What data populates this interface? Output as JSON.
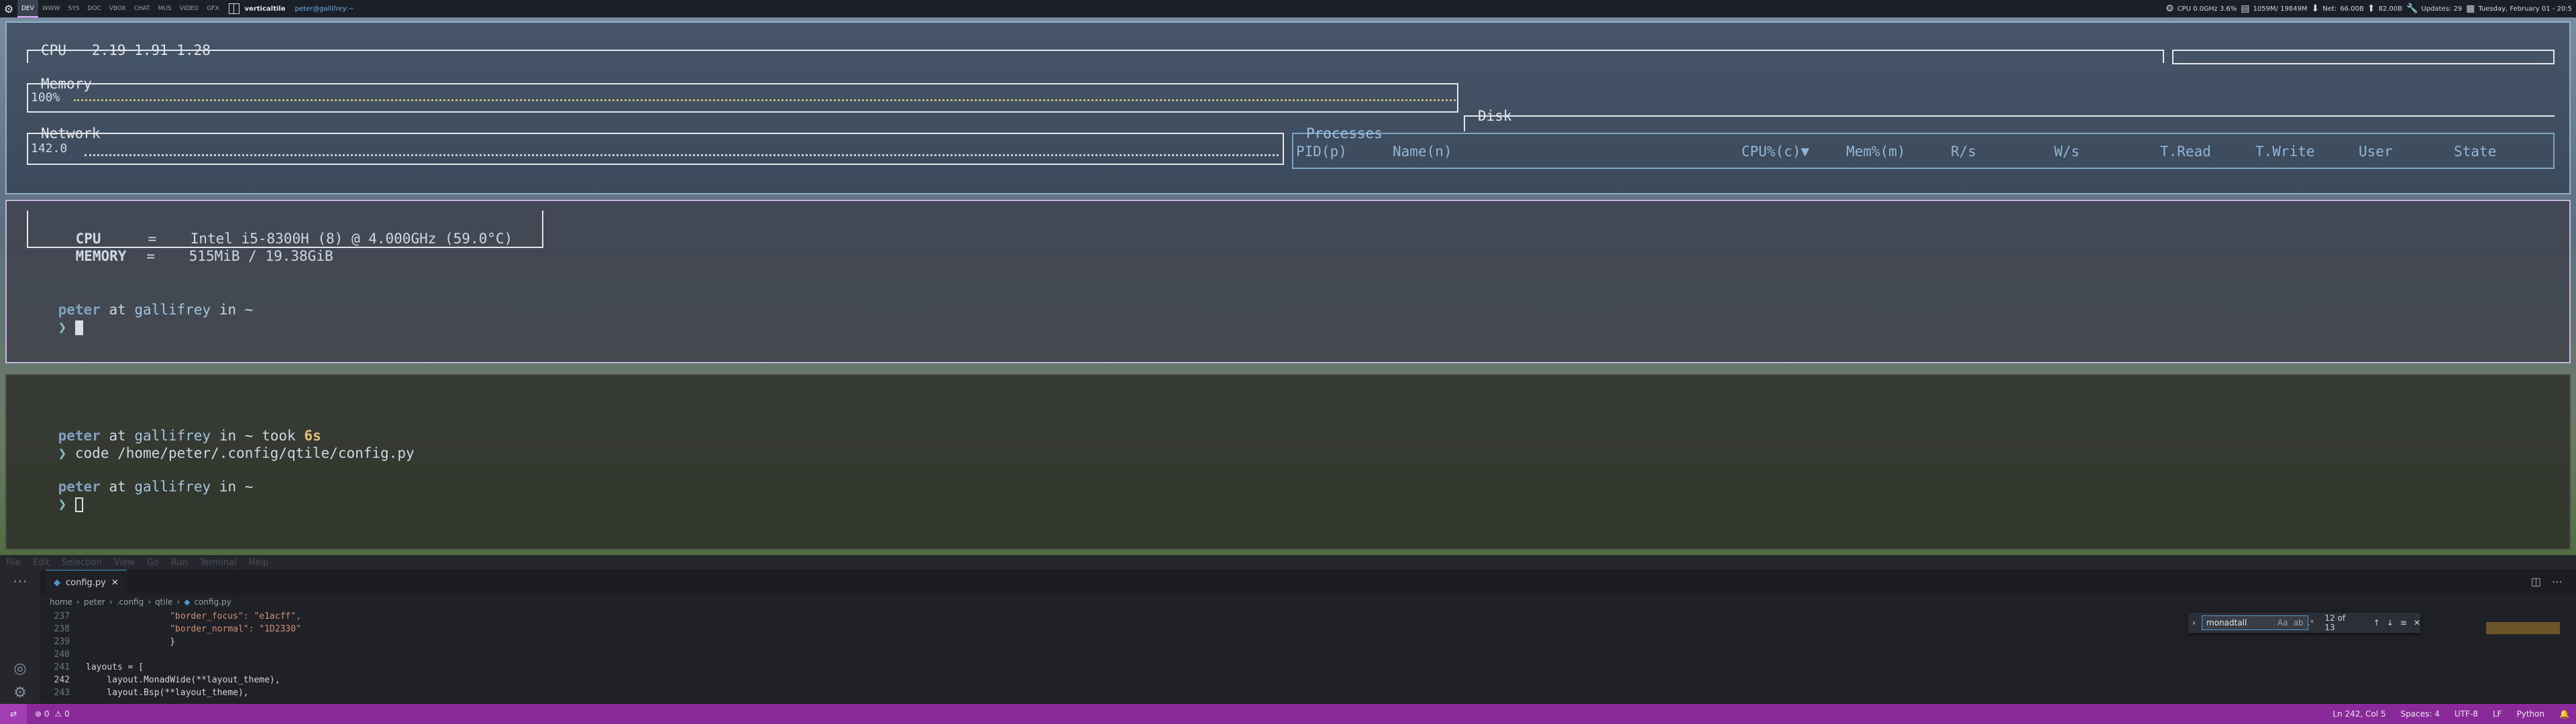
{
  "topbar": {
    "groups": [
      "DEV",
      "WWW",
      "SYS",
      "DOC",
      "VBOX",
      "CHAT",
      "MUS",
      "VIDEO",
      "GFX"
    ],
    "layout_name": "verticaltile",
    "window_title": "peter@gallifrey:~",
    "cpu": "CPU 0.0GHz 3.6%",
    "memory": "1059M/ 19849M",
    "net_label": "Net:",
    "net_down": "66.00B",
    "net_up": "82.00B",
    "updates": "Updates: 29",
    "date": "Tuesday, February 01 - 20:5"
  },
  "bpytop": {
    "cpu_title": "CPU ─ 2.19 1.91 1.28",
    "mem_title": "Memory",
    "mem_value": "100%",
    "disk_title": "Disk",
    "net_title": "Network",
    "net_value": "142.0",
    "proc_title": "Processes",
    "proc_columns": [
      "PID(p)",
      "Name(n)",
      "CPU%(c)▼",
      "Mem%(m)",
      "R/s",
      "W/s",
      "T.Read",
      "T.Write",
      "User",
      "State"
    ]
  },
  "neofetch": {
    "cpu_label": "CPU",
    "cpu_value": "=    Intel i5-8300H (8) @ 4.000GHz (59.0°C)",
    "mem_label": "MEMORY",
    "mem_value": "=    515MiB / 19.38GiB"
  },
  "prompt": {
    "user": "peter",
    "at": "at",
    "host": "gallifrey",
    "in": "in ~",
    "arrow": "❯",
    "took": "took",
    "took_time": "6s",
    "command": "code /home/peter/.config/qtile/config.py"
  },
  "vscode": {
    "menu": [
      "File",
      "Edit",
      "Selection",
      "View",
      "Go",
      "Run",
      "Terminal",
      "Help"
    ],
    "tab_label": "config.py",
    "breadcrumb": [
      "home",
      "peter",
      ".config",
      "qtile",
      "config.py"
    ],
    "lines": [
      {
        "n": "237",
        "text": "                \"border_focus\": \"e1acff\","
      },
      {
        "n": "238",
        "text": "                \"border_normal\": \"1D2330\""
      },
      {
        "n": "239",
        "text": "                }"
      },
      {
        "n": "240",
        "text": ""
      },
      {
        "n": "241",
        "text": "layouts = ["
      },
      {
        "n": "242",
        "text": "    layout.MonadWide(**layout_theme),"
      },
      {
        "n": "243",
        "text": "    layout.Bsp(**layout_theme),"
      }
    ],
    "find_value": "monadtall",
    "find_count": "12 of 13",
    "find_opts": "Aa",
    "status": {
      "errors": "⊗ 0",
      "warnings": "⚠ 0",
      "position": "Ln 242, Col 5",
      "spaces": "Spaces: 4",
      "encoding": "UTF-8",
      "eol": "LF",
      "language": "Python"
    }
  }
}
